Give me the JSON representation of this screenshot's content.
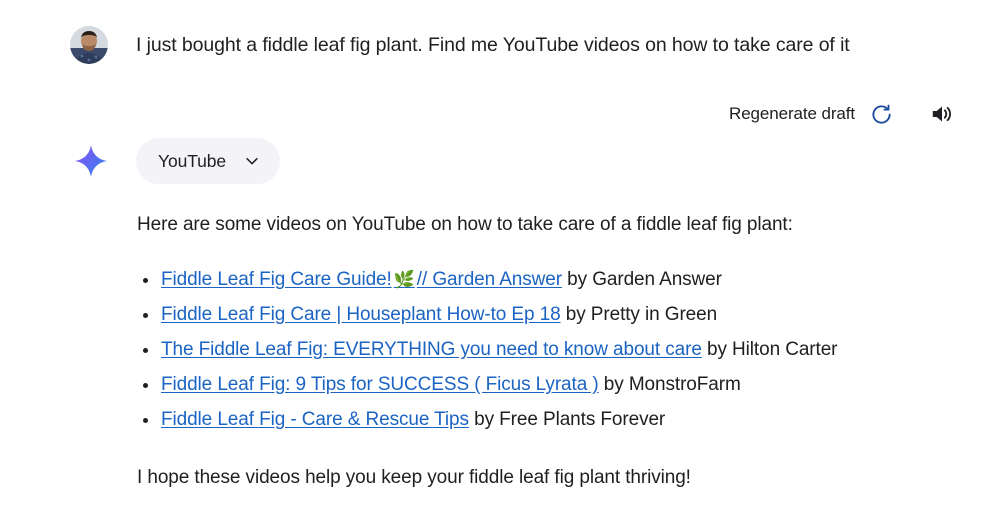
{
  "prompt": {
    "avatar_name": "user-avatar-photo",
    "text": "I just bought a fiddle leaf fig plant. Find me YouTube videos on how to take care of it"
  },
  "toolbar": {
    "regenerate_label": "Regenerate draft",
    "refresh_icon": "refresh-icon",
    "speaker_icon": "speaker-icon",
    "refresh_color": "#1b4a9c",
    "speaker_color": "#202124"
  },
  "source_chip": {
    "sparkle_icon": "gemini-sparkle-icon",
    "label": "YouTube",
    "chevron_icon": "chevron-down-icon",
    "background": "#f4f3f8"
  },
  "answer": {
    "intro": "Here are some videos on YouTube on how to take care of a fiddle leaf fig plant:",
    "videos": [
      {
        "title_before_emoji": "Fiddle Leaf Fig Care Guide!",
        "emoji": "🌿",
        "title_after_emoji": "// Garden Answer",
        "byline": "by Garden Answer"
      },
      {
        "title_before_emoji": "Fiddle Leaf Fig Care | Houseplant How-to Ep 18",
        "emoji": "",
        "title_after_emoji": "",
        "byline": "by Pretty in Green"
      },
      {
        "title_before_emoji": "The Fiddle Leaf Fig: EVERYTHING you need to know about care",
        "emoji": "",
        "title_after_emoji": "",
        "byline": "by Hilton Carter"
      },
      {
        "title_before_emoji": "Fiddle Leaf Fig: 9 Tips for SUCCESS ( Ficus Lyrata )",
        "emoji": "",
        "title_after_emoji": "",
        "byline": "by MonstroFarm"
      },
      {
        "title_before_emoji": "Fiddle Leaf Fig - Care & Rescue Tips",
        "emoji": "",
        "title_after_emoji": "",
        "byline": "by Free Plants Forever"
      }
    ],
    "closing": "I hope these videos help you keep your fiddle leaf fig plant thriving!",
    "link_color": "#1b64c4"
  }
}
